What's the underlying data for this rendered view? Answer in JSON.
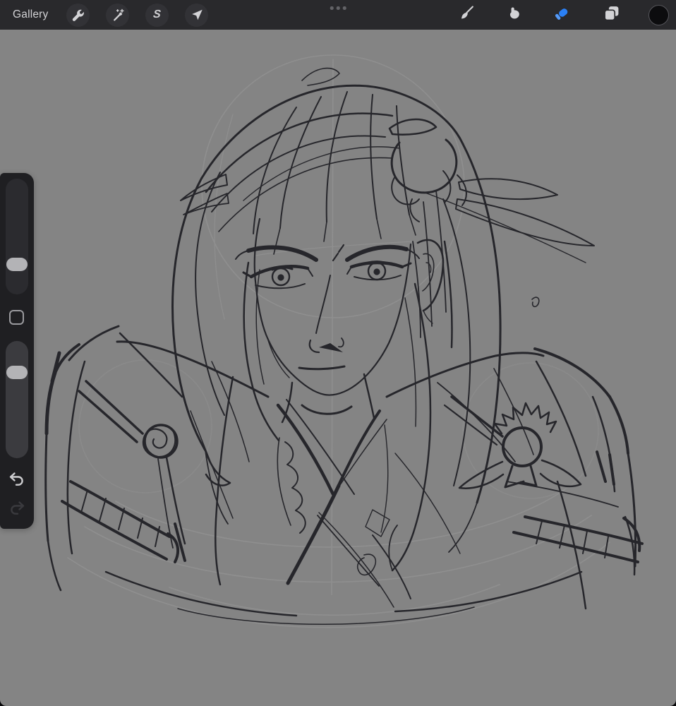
{
  "topbar": {
    "gallery_label": "Gallery",
    "left_tools": [
      {
        "name": "actions",
        "icon": "wrench-icon"
      },
      {
        "name": "adjustments",
        "icon": "magic-wand-icon"
      },
      {
        "name": "selection",
        "icon": "selection-s-icon",
        "glyph": "S"
      },
      {
        "name": "transform",
        "icon": "transform-arrow-icon"
      }
    ],
    "more_indicator_dots": 3,
    "right_tools": [
      {
        "name": "paint",
        "icon": "brush-icon",
        "active": false
      },
      {
        "name": "smudge",
        "icon": "smudge-icon",
        "active": false
      },
      {
        "name": "erase",
        "icon": "eraser-icon",
        "active": true
      },
      {
        "name": "layers",
        "icon": "layers-icon",
        "active": false
      },
      {
        "name": "color",
        "icon": "color-swatch",
        "active": false,
        "current_color": "#0c0c0e"
      }
    ],
    "active_tool": "erase"
  },
  "sidebar": {
    "size_slider": {
      "fraction_from_top": 0.77
    },
    "opacity_slider": {
      "fraction_from_top": 0.24
    },
    "modify_button": {
      "icon": "modify-square-icon"
    },
    "undo": {
      "icon": "undo-arrow-icon",
      "enabled": true
    },
    "redo": {
      "icon": "redo-arrow-icon",
      "enabled": false
    }
  },
  "canvas": {
    "description": "Grayscale pencil sketch of a stern long-haired character facing the viewer, wearing layered robes with a crossed collar, a spiral rosette on the left shoulder, a flower ornament on the right shoulder, wrapped armbands, feather-like hair strands swept to the right, over faint construction guide lines",
    "background": "#848484",
    "ink_color": "#26262b",
    "guide_color": "#9a9a9a"
  },
  "colors": {
    "accent_blue": "#2a80f6",
    "topbar_bg": "#29292c",
    "button_bg": "#323236",
    "icon": "#d3d3d6",
    "sidebar_bg": "#1f1f22",
    "slider_handle": "#b3b3b6"
  }
}
